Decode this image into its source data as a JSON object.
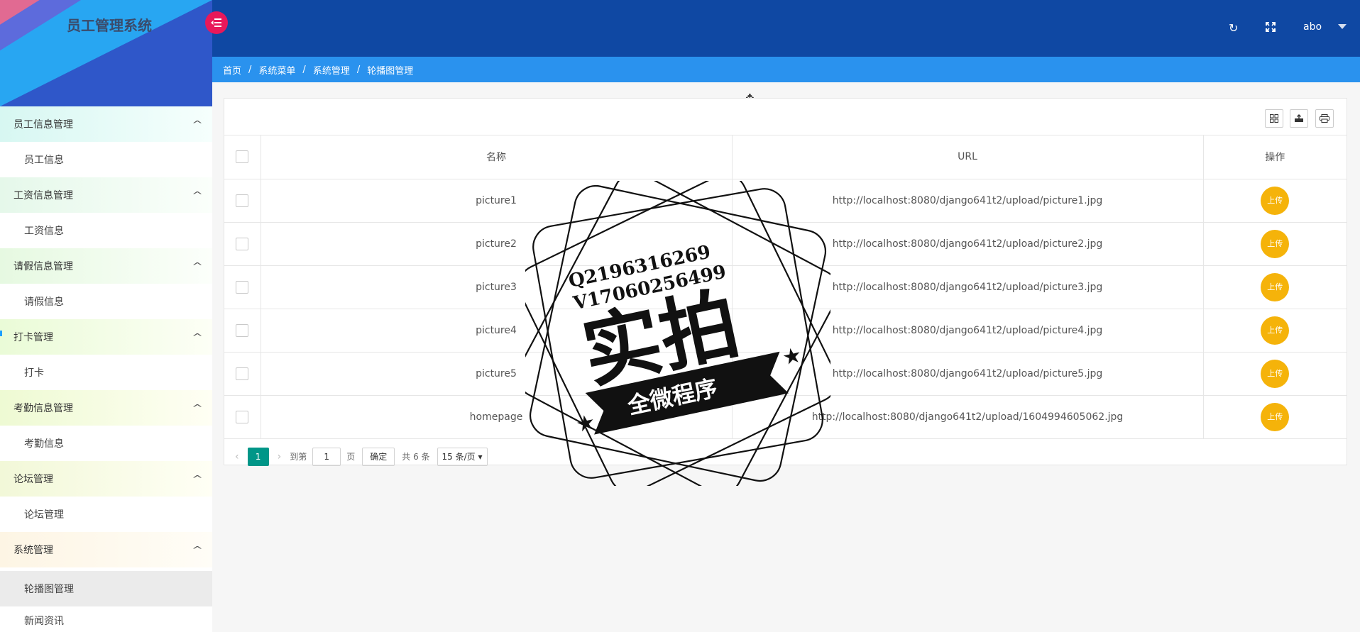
{
  "app": {
    "title": "员工管理系统"
  },
  "sidebar": {
    "groups": [
      {
        "label": "员工信息管理",
        "items": [
          "员工信息"
        ]
      },
      {
        "label": "工资信息管理",
        "items": [
          "工资信息"
        ]
      },
      {
        "label": "请假信息管理",
        "items": [
          "请假信息"
        ]
      },
      {
        "label": "打卡管理",
        "items": [
          "打卡"
        ]
      },
      {
        "label": "考勤信息管理",
        "items": [
          "考勤信息"
        ]
      },
      {
        "label": "论坛管理",
        "items": [
          "论坛管理"
        ]
      },
      {
        "label": "系统管理",
        "items": [
          "轮播图管理",
          "新闻资讯"
        ]
      }
    ],
    "active_item": "轮播图管理"
  },
  "header": {
    "user": "abo"
  },
  "breadcrumb": [
    "首页",
    "系统菜单",
    "系统管理",
    "轮播图管理"
  ],
  "table": {
    "columns": [
      "名称",
      "URL",
      "操作"
    ],
    "rows": [
      {
        "name": "picture1",
        "url": "http://localhost:8080/django641t2/upload/picture1.jpg",
        "action": "上传"
      },
      {
        "name": "picture2",
        "url": "http://localhost:8080/django641t2/upload/picture2.jpg",
        "action": "上传"
      },
      {
        "name": "picture3",
        "url": "http://localhost:8080/django641t2/upload/picture3.jpg",
        "action": "上传"
      },
      {
        "name": "picture4",
        "url": "http://localhost:8080/django641t2/upload/picture4.jpg",
        "action": "上传"
      },
      {
        "name": "picture5",
        "url": "http://localhost:8080/django641t2/upload/picture5.jpg",
        "action": "上传"
      },
      {
        "name": "homepage",
        "url": "http://localhost:8080/django641t2/upload/1604994605062.jpg",
        "action": "上传"
      }
    ]
  },
  "pager": {
    "current": "1",
    "goto_label": "到第",
    "goto_value": "1",
    "page_unit": "页",
    "confirm": "确定",
    "total": "共 6 条",
    "page_size": "15 条/页"
  },
  "watermark": {
    "line1": "Q2196316269",
    "line2": "V17060256499",
    "big": "实拍",
    "banner": "全微程序"
  },
  "colors": {
    "topbar": "#0f48a3",
    "breadcrumb": "#2a92ee",
    "upload": "#f5b30a",
    "pager_current": "#009688",
    "toggle": "#e8185a"
  }
}
